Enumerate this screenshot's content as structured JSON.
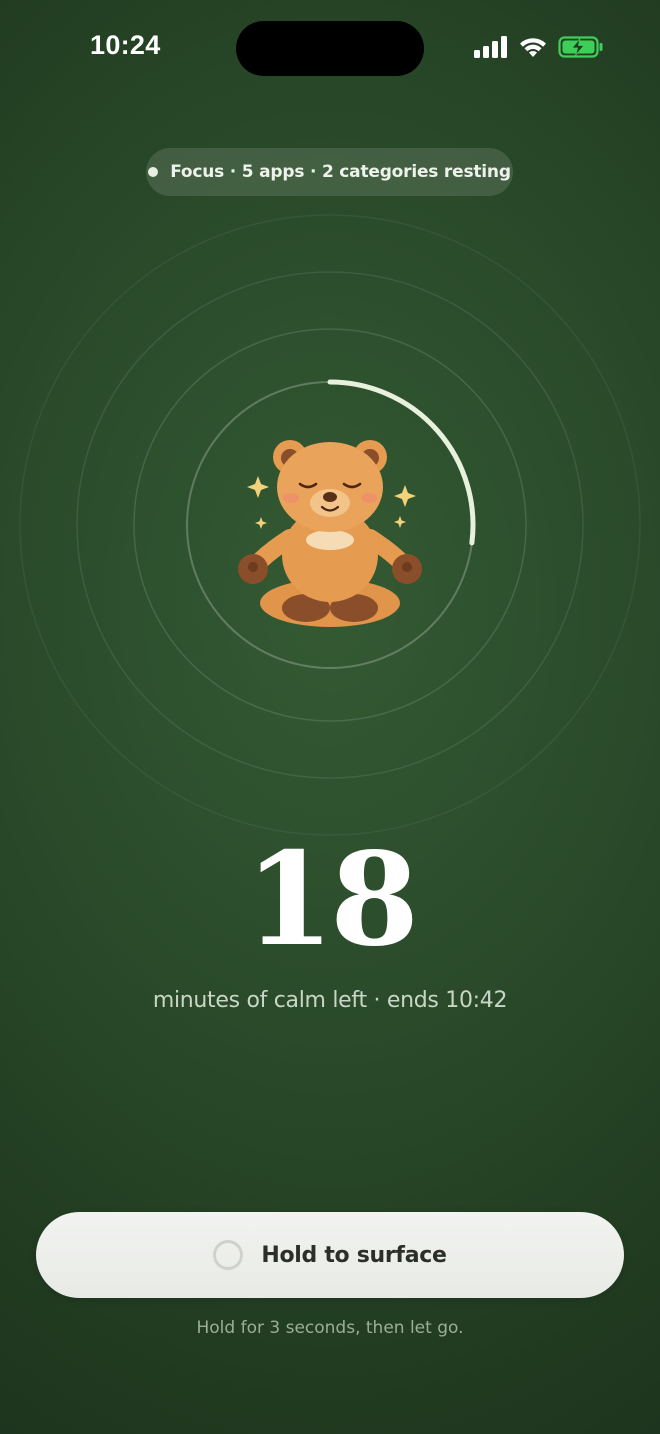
{
  "status_bar": {
    "time": "10:24",
    "icons": [
      "cellular-signal-icon",
      "wifi-icon",
      "battery-charging-icon"
    ],
    "battery_color": "#3ecf5a"
  },
  "focus": {
    "label": "Focus · 5 apps · 2 categories resting"
  },
  "session": {
    "minutes_left": "18",
    "subtitle": "minutes of calm left · ends 10:42",
    "arc_progress": 0.27,
    "illustration": "meditating-bear"
  },
  "hold": {
    "button_label": "Hold to surface",
    "hint": "Hold for 3 seconds, then let go."
  },
  "colors": {
    "background": "#2a4a2a",
    "arc": "#e8f1dd",
    "button": "#eef0ec"
  }
}
